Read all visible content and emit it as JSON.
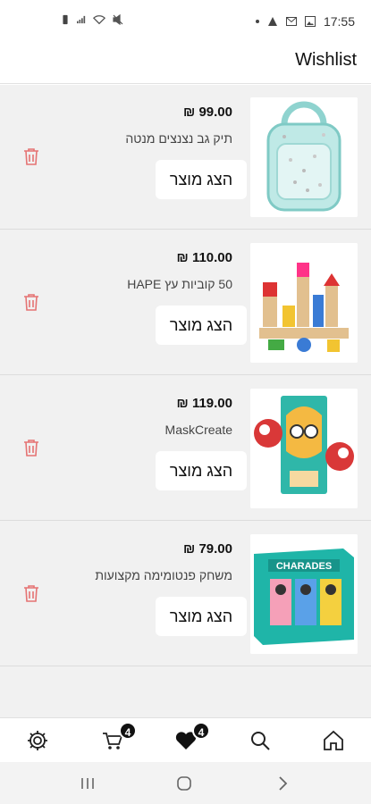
{
  "status_bar": {
    "time": "17:55"
  },
  "header": {
    "title": "Wishlist"
  },
  "items": [
    {
      "price": "99.00 ₪",
      "name": "תיק גב נצנצים מנטה",
      "button": "הצג מוצר",
      "image": "mint-glitter-backpack"
    },
    {
      "price": "110.00 ₪",
      "name": "50 קוביות עץ HAPE",
      "button": "הצג מוצר",
      "image": "wooden-blocks"
    },
    {
      "price": "119.00 ₪",
      "name": "MaskCreate",
      "button": "הצג מוצר",
      "image": "mask-create-kit"
    },
    {
      "price": "79.00 ₪",
      "name": "משחק פנטומימה מקצועות",
      "button": "הצג מוצר",
      "image": "charades-game"
    }
  ],
  "bottom_nav": {
    "cart_count": "4",
    "wishlist_count": "4",
    "icons": [
      "gear-icon",
      "cart-icon",
      "heart-icon",
      "search-icon",
      "home-icon"
    ]
  },
  "colors": {
    "trash": "#e57373",
    "list_bg": "#f1f1f1",
    "badge": "#111111",
    "box_teal": "#1fb5a8"
  }
}
